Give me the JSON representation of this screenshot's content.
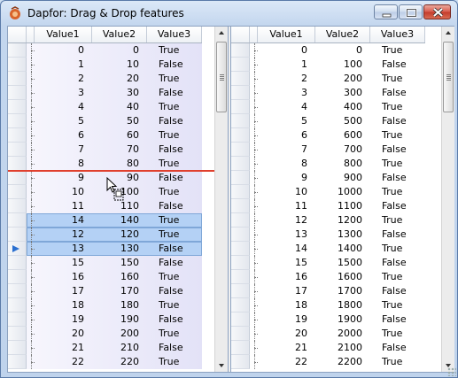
{
  "window": {
    "title": "Dapfor: Drag & Drop features"
  },
  "colors": {
    "selection": "#b4d1f5",
    "drop_indicator": "#e0402e",
    "row_tint": "#ebeaf9"
  },
  "left_grid": {
    "columns": [
      "Value1",
      "Value2",
      "Value3"
    ],
    "rows": [
      {
        "v1": "0",
        "v2": "0",
        "v3": "True"
      },
      {
        "v1": "1",
        "v2": "10",
        "v3": "False"
      },
      {
        "v1": "2",
        "v2": "20",
        "v3": "True"
      },
      {
        "v1": "3",
        "v2": "30",
        "v3": "False"
      },
      {
        "v1": "4",
        "v2": "40",
        "v3": "True"
      },
      {
        "v1": "5",
        "v2": "50",
        "v3": "False"
      },
      {
        "v1": "6",
        "v2": "60",
        "v3": "True"
      },
      {
        "v1": "7",
        "v2": "70",
        "v3": "False"
      },
      {
        "v1": "8",
        "v2": "80",
        "v3": "True"
      },
      {
        "v1": "9",
        "v2": "90",
        "v3": "False"
      },
      {
        "v1": "10",
        "v2": "100",
        "v3": "True"
      },
      {
        "v1": "11",
        "v2": "110",
        "v3": "False"
      },
      {
        "v1": "14",
        "v2": "140",
        "v3": "True",
        "selected": true
      },
      {
        "v1": "12",
        "v2": "120",
        "v3": "True",
        "selected": true
      },
      {
        "v1": "13",
        "v2": "130",
        "v3": "False",
        "selected": true,
        "current": true
      },
      {
        "v1": "15",
        "v2": "150",
        "v3": "False"
      },
      {
        "v1": "16",
        "v2": "160",
        "v3": "True"
      },
      {
        "v1": "17",
        "v2": "170",
        "v3": "False"
      },
      {
        "v1": "18",
        "v2": "180",
        "v3": "True"
      },
      {
        "v1": "19",
        "v2": "190",
        "v3": "False"
      },
      {
        "v1": "20",
        "v2": "200",
        "v3": "True"
      },
      {
        "v1": "21",
        "v2": "210",
        "v3": "False"
      },
      {
        "v1": "22",
        "v2": "220",
        "v3": "True"
      }
    ]
  },
  "right_grid": {
    "columns": [
      "Value1",
      "Value2",
      "Value3"
    ],
    "rows": [
      {
        "v1": "0",
        "v2": "0",
        "v3": "True"
      },
      {
        "v1": "1",
        "v2": "100",
        "v3": "False"
      },
      {
        "v1": "2",
        "v2": "200",
        "v3": "True"
      },
      {
        "v1": "3",
        "v2": "300",
        "v3": "False"
      },
      {
        "v1": "4",
        "v2": "400",
        "v3": "True"
      },
      {
        "v1": "5",
        "v2": "500",
        "v3": "False"
      },
      {
        "v1": "6",
        "v2": "600",
        "v3": "True"
      },
      {
        "v1": "7",
        "v2": "700",
        "v3": "False"
      },
      {
        "v1": "8",
        "v2": "800",
        "v3": "True"
      },
      {
        "v1": "9",
        "v2": "900",
        "v3": "False"
      },
      {
        "v1": "10",
        "v2": "1000",
        "v3": "True"
      },
      {
        "v1": "11",
        "v2": "1100",
        "v3": "False"
      },
      {
        "v1": "12",
        "v2": "1200",
        "v3": "True"
      },
      {
        "v1": "13",
        "v2": "1300",
        "v3": "False"
      },
      {
        "v1": "14",
        "v2": "1400",
        "v3": "True"
      },
      {
        "v1": "15",
        "v2": "1500",
        "v3": "False"
      },
      {
        "v1": "16",
        "v2": "1600",
        "v3": "True"
      },
      {
        "v1": "17",
        "v2": "1700",
        "v3": "False"
      },
      {
        "v1": "18",
        "v2": "1800",
        "v3": "True"
      },
      {
        "v1": "19",
        "v2": "1900",
        "v3": "False"
      },
      {
        "v1": "20",
        "v2": "2000",
        "v3": "True"
      },
      {
        "v1": "21",
        "v2": "2100",
        "v3": "False"
      },
      {
        "v1": "22",
        "v2": "2200",
        "v3": "True"
      }
    ]
  },
  "icons": [
    "app-icon",
    "minimize-icon",
    "maximize-icon",
    "close-icon",
    "drag-copy-cursor-icon",
    "current-row-arrow-icon"
  ]
}
